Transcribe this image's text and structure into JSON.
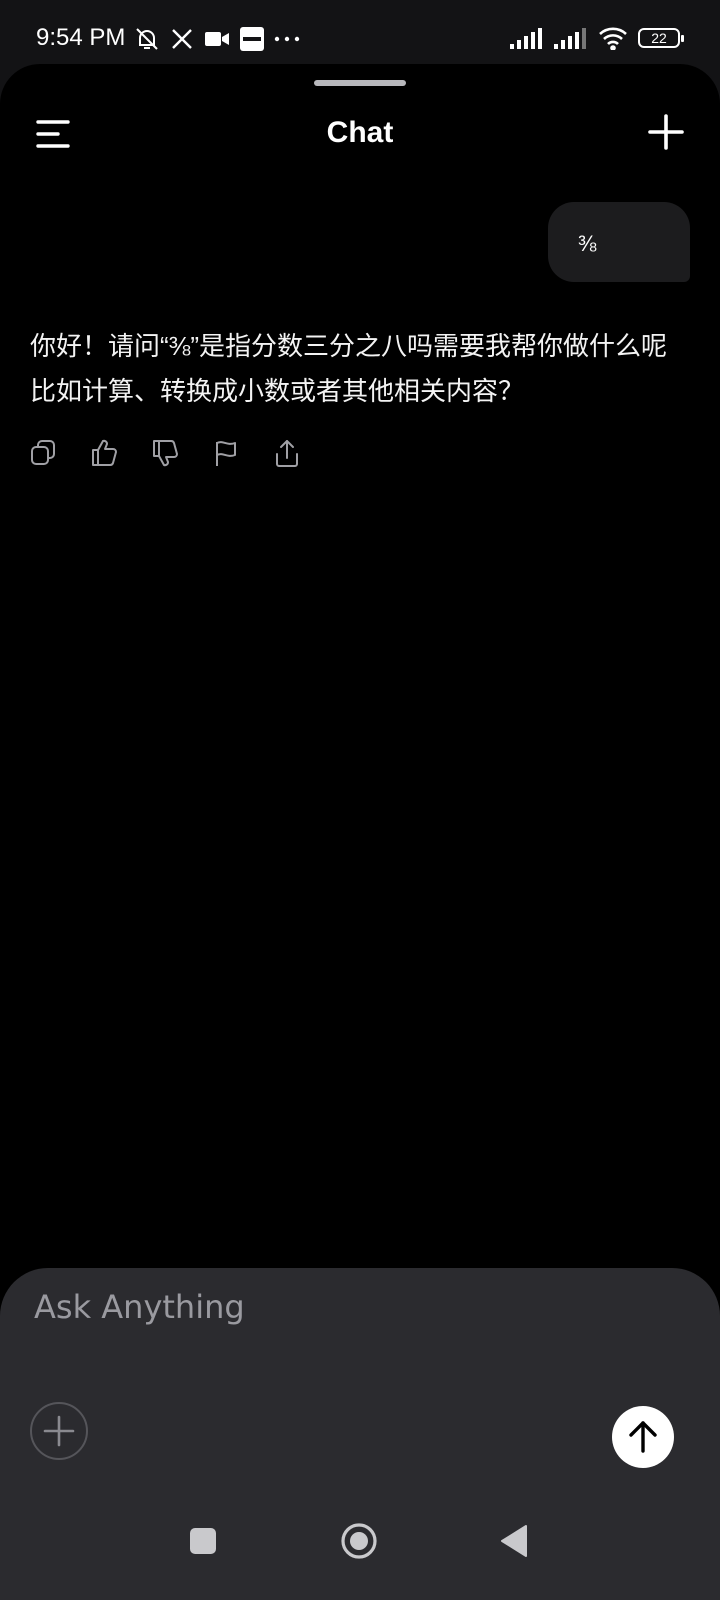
{
  "status_bar": {
    "time": "9:54 PM",
    "battery_level": "22",
    "left_icons": [
      "mute-bell-icon",
      "x-logo-icon",
      "video-camera-icon",
      "bybit-app-icon",
      "more-dots-icon"
    ],
    "right_icons": [
      "signal-icon",
      "signal-icon",
      "wifi-icon",
      "battery-icon"
    ]
  },
  "header": {
    "title": "Chat",
    "menu_icon": "menu-icon",
    "new_chat_icon": "plus-icon"
  },
  "conversation": {
    "user_message": "⅜",
    "assistant_message": "你好！请问“⅜”是指分数三分之八吗需要我帮你做什么呢比如计算、转换成小数或者其他相关内容？",
    "actions": [
      "copy-icon",
      "thumbs-up-icon",
      "thumbs-down-icon",
      "flag-icon",
      "share-icon"
    ]
  },
  "composer": {
    "placeholder": "Ask Anything",
    "value": ""
  },
  "nav": {
    "icons": [
      "recents-square-icon",
      "home-circle-icon",
      "back-triangle-icon"
    ]
  },
  "colors": {
    "background": "#000000",
    "composer_bg": "#2b2b2f",
    "bubble_bg": "#1c1c1e",
    "accent": "#ffffff"
  }
}
